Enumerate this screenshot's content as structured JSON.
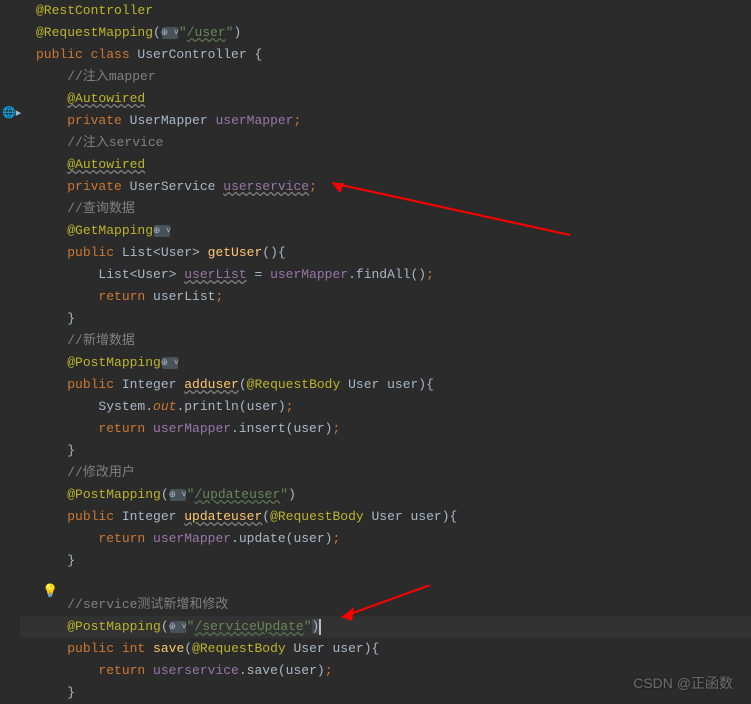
{
  "code": {
    "l1": "@RestController",
    "l2a": "@RequestMapping",
    "l2b": "(",
    "l2c": "\"",
    "l2d": "/user",
    "l2e": "\"",
    "l2f": ")",
    "l3a": "public ",
    "l3b": "class ",
    "l3c": "UserController ",
    "l3d": "{",
    "l4": "//注入mapper",
    "l5": "@Autowired",
    "l6a": "private ",
    "l6b": "UserMapper ",
    "l6c": "userMapper",
    "l6d": ";",
    "l7": "//注入service",
    "l8": "@Autowired",
    "l9a": "private ",
    "l9b": "UserService ",
    "l9c": "userservice",
    "l9d": ";",
    "l10": "//查询数据",
    "l11": "@GetMapping",
    "l12a": "public ",
    "l12b": "List<User> ",
    "l12c": "getUser",
    "l12d": "(){",
    "l13a": "List<User> ",
    "l13b": "userList",
    "l13c": " = ",
    "l13d": "userMapper",
    "l13e": ".findAll()",
    "l13f": ";",
    "l14a": "return ",
    "l14b": "userList",
    "l14c": ";",
    "l15": "}",
    "l16": "//新增数据",
    "l17": "@PostMapping",
    "l18a": "public ",
    "l18b": "Integer ",
    "l18c": "adduser",
    "l18d": "(",
    "l18e": "@RequestBody ",
    "l18f": "User user){",
    "l19a": "System.",
    "l19b": "out",
    "l19c": ".println(user)",
    "l19d": ";",
    "l20a": "return ",
    "l20b": "userMapper",
    "l20c": ".insert(user)",
    "l20d": ";",
    "l21": "}",
    "l22": "//修改用户",
    "l23a": "@PostMapping",
    "l23b": "(",
    "l23c": "\"",
    "l23d": "/updateuser",
    "l23e": "\"",
    "l23f": ")",
    "l24a": "public ",
    "l24b": "Integer ",
    "l24c": "updateuser",
    "l24d": "(",
    "l24e": "@RequestBody ",
    "l24f": "User user){",
    "l25a": "return ",
    "l25b": "userMapper",
    "l25c": ".update(user)",
    "l25d": ";",
    "l26": "}",
    "l27": "",
    "l28": "//service测试新增和修改",
    "l29a": "@PostMapping",
    "l29b": "(",
    "l29c": "\"",
    "l29d": "/serviceUpdate",
    "l29e": "\"",
    "l29f": ")",
    "l30a": "public ",
    "l30b": "int ",
    "l30c": "save",
    "l30d": "(",
    "l30e": "@RequestBody ",
    "l30f": "User user){",
    "l31a": "return ",
    "l31b": "userservice",
    "l31c": ".save(user)",
    "l31d": ";",
    "l32": "}"
  },
  "globe": "⊕ ˅",
  "watermark": "CSDN @正函数",
  "gutter": {
    "bulb": "💡",
    "earth": "🌐▸"
  }
}
